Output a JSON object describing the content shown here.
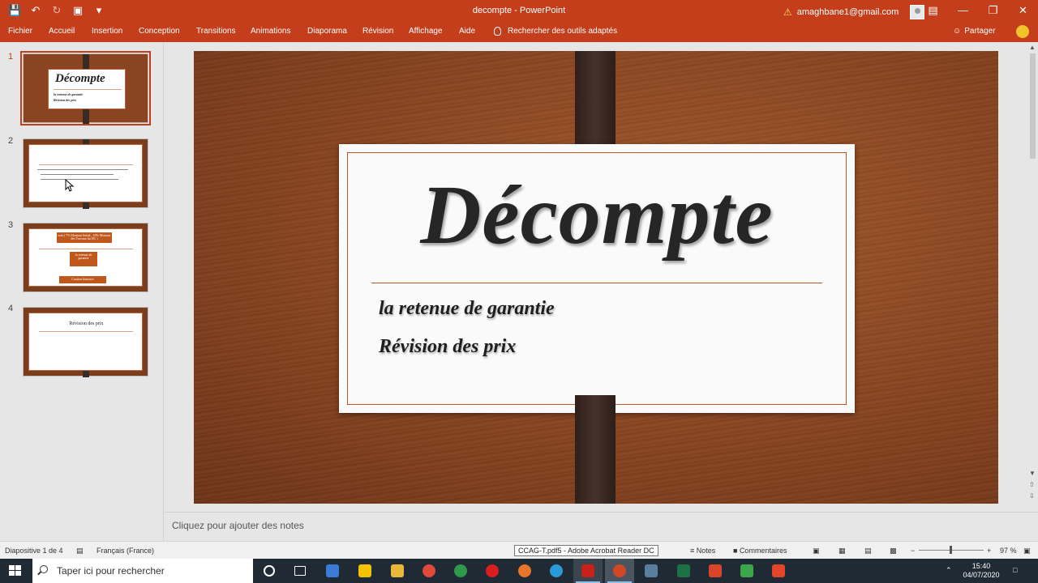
{
  "window": {
    "title": "decompte  -  PowerPoint",
    "account": "amaghbane1@gmail.com"
  },
  "ribbon": {
    "tabs": [
      "Fichier",
      "Accueil",
      "Insertion",
      "Conception",
      "Transitions",
      "Animations",
      "Diaporama",
      "Révision",
      "Affichage",
      "Aide"
    ],
    "tell_me": "Rechercher des outils adaptés",
    "share": "Partager"
  },
  "thumbnails": {
    "numbers": [
      "1",
      "2",
      "3",
      "4"
    ],
    "slide1_title": "Décompte",
    "slide1_line1": "la retenue de garantie",
    "slide1_line2": "Révision des prix",
    "slide3_box1": "min ( 7% Montant Initial , 10% Montant des Travaux du DC )",
    "slide3_box2": "la retenue de garantie",
    "slide3_box3": "Caution bancaire",
    "slide4_title": "Révision des prix"
  },
  "slide": {
    "title": "Décompte",
    "subtitle1": "la retenue de garantie",
    "subtitle2": "Révision des prix"
  },
  "notes": {
    "placeholder": "Cliquez pour ajouter des notes"
  },
  "status": {
    "slide_info": "Diapositive 1 de 4",
    "language": "Français (France)",
    "tooltip": "CCAG-T.pdf5 - Adobe Acrobat Reader DC",
    "notes_label": "Notes",
    "comments_label": "Commentaires",
    "zoom": "97 %"
  },
  "taskbar": {
    "search_placeholder": "Taper ici pour rechercher",
    "time": "15:40",
    "date": "04/07/2020"
  },
  "colors": {
    "accent": "#c43e1c",
    "taskbar": "#1f2a34"
  }
}
